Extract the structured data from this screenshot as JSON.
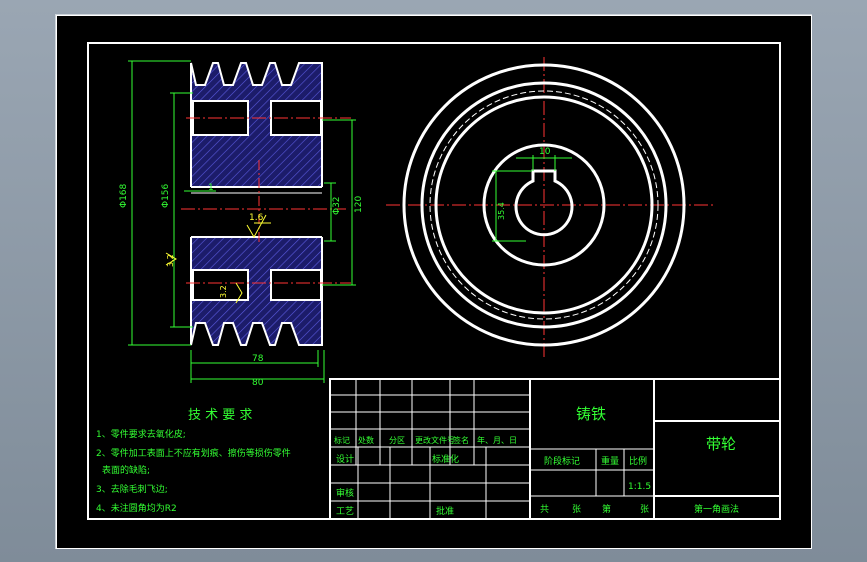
{
  "drawing": {
    "dimensions": {
      "d168": "Φ168",
      "d156": "Φ156",
      "d32": "Φ32",
      "d120": "120",
      "w78": "78",
      "w80": "80",
      "one": "1",
      "key10": "10",
      "key35": "35.4",
      "rough16": "1.6",
      "rough32a": "3.2",
      "rough32b": "3.2"
    },
    "requirements": {
      "title": "技 术 要 求",
      "items": [
        "1、零件要求去氧化皮;",
        "2、零件加工表面上不应有划痕、擦伤等损伤零件",
        "表面的缺陷;",
        "3、去除毛刺飞边;",
        "4、未注圆角均为R2"
      ]
    },
    "title_block": {
      "material": "铸铁",
      "part_name": "带轮",
      "row_labels": [
        "标记",
        "处数",
        "分区",
        "更改文件号",
        "签名",
        "年、月、日"
      ],
      "design": "设计",
      "standard": "标准化",
      "review": "审核",
      "process": "工艺",
      "approve": "批准",
      "stage_mark": "阶段标记",
      "weight": "重量",
      "scale_label": "比例",
      "scale": "1:1.5",
      "total": "共",
      "sheets": "张",
      "num": "第",
      "sheet_num": "张",
      "projection": "第一角画法"
    }
  }
}
